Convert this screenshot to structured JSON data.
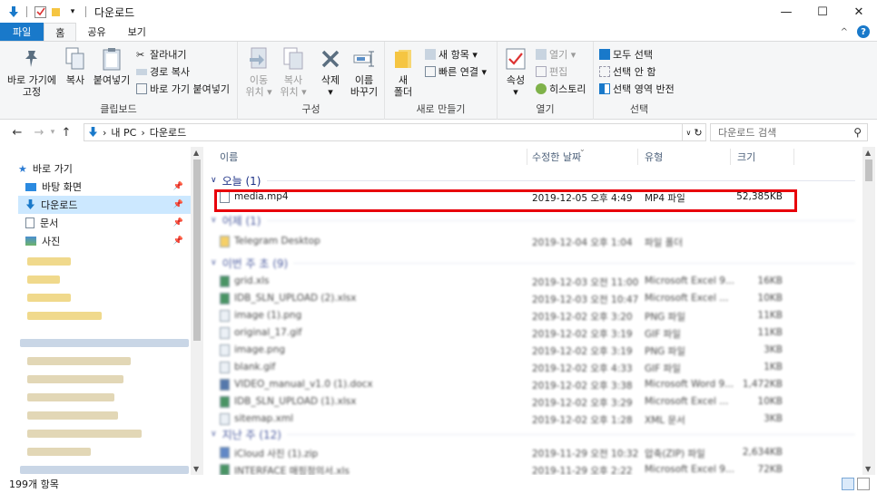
{
  "window": {
    "title": "다운로드",
    "controls": {
      "minimize": "—",
      "maximize": "☐",
      "close": "✕"
    }
  },
  "ribbon_tabs": [
    "파일",
    "홈",
    "공유",
    "보기"
  ],
  "ribbon": {
    "clipboard": {
      "pin": "바로 가기에\n고정",
      "copy": "복사",
      "paste": "붙여넣기",
      "cut": "잘라내기",
      "copy_path": "경로 복사",
      "paste_shortcut": "바로 가기 붙여넣기",
      "label": "클립보드"
    },
    "organize": {
      "move_to": "이동\n위치 ▾",
      "copy_to": "복사\n위치 ▾",
      "delete": "삭제\n▾",
      "rename": "이름\n바꾸기",
      "label": "구성"
    },
    "new": {
      "new_folder": "새\n폴더",
      "new_item": "새 항목 ▾",
      "easy_access": "빠른 연결 ▾",
      "label": "새로 만들기"
    },
    "open": {
      "properties": "속성\n▾",
      "open": "열기 ▾",
      "edit": "편집",
      "history": "히스토리",
      "label": "열기"
    },
    "select": {
      "select_all": "모두 선택",
      "select_none": "선택 안 함",
      "invert": "선택 영역 반전",
      "label": "선택"
    }
  },
  "address": {
    "path": [
      "내 PC",
      "다운로드"
    ],
    "search_placeholder": "다운로드 검색"
  },
  "nav": {
    "quick_access": "바로 가기",
    "items": [
      "바탕 화면",
      "다운로드",
      "문서",
      "사진"
    ]
  },
  "columns": {
    "name": "이름",
    "date": "수정한 날짜",
    "type": "유형",
    "size": "크기"
  },
  "groups": {
    "today": {
      "label": "오늘 (1)"
    },
    "yesterday": {
      "label": "어제 (1)"
    },
    "this_week": {
      "label": "이번 주 초 (9)"
    },
    "last_week": {
      "label": "지난 주 (12)"
    }
  },
  "files": {
    "today": [
      {
        "name": "media.mp4",
        "date": "2019-12-05 오후 4:49",
        "type": "MP4 파일",
        "size": "52,385KB"
      }
    ],
    "yesterday": [
      {
        "name": "Telegram Desktop",
        "date": "2019-12-04 오후 1:04",
        "type": "파일 폴더",
        "size": ""
      }
    ],
    "this_week": [
      {
        "name": "grid.xls",
        "date": "2019-12-03 오전 11:00",
        "type": "Microsoft Excel 9...",
        "size": "16KB"
      },
      {
        "name": "IDB_SLN_UPLOAD (2).xlsx",
        "date": "2019-12-03 오전 10:47",
        "type": "Microsoft Excel ...",
        "size": "10KB"
      },
      {
        "name": "image (1).png",
        "date": "2019-12-02 오후 3:20",
        "type": "PNG 파일",
        "size": "11KB"
      },
      {
        "name": "original_17.gif",
        "date": "2019-12-02 오후 3:19",
        "type": "GIF 파일",
        "size": "11KB"
      },
      {
        "name": "image.png",
        "date": "2019-12-02 오후 3:19",
        "type": "PNG 파일",
        "size": "3KB"
      },
      {
        "name": "blank.gif",
        "date": "2019-12-02 오후 4:33",
        "type": "GIF 파일",
        "size": "1KB"
      },
      {
        "name": "VIDEO_manual_v1.0 (1).docx",
        "date": "2019-12-02 오후 3:38",
        "type": "Microsoft Word 9...",
        "size": "1,472KB"
      },
      {
        "name": "IDB_SLN_UPLOAD (1).xlsx",
        "date": "2019-12-02 오후 3:29",
        "type": "Microsoft Excel ...",
        "size": "10KB"
      },
      {
        "name": "sitemap.xml",
        "date": "2019-12-02 오후 1:28",
        "type": "XML 문서",
        "size": "3KB"
      }
    ],
    "last_week": [
      {
        "name": "iCloud 사진 (1).zip",
        "date": "2019-11-29 오전 10:32",
        "type": "압축(ZIP) 파일",
        "size": "2,634KB"
      },
      {
        "name": "INTERFACE 매핑정의서.xls",
        "date": "2019-11-29 오후 2:22",
        "type": "Microsoft Excel 9...",
        "size": "72KB"
      }
    ]
  },
  "status": {
    "count": "199개 항목"
  },
  "colors": {
    "accent": "#1979ca",
    "highlight": "#e8000b",
    "group_header": "#1e3287",
    "selected": "#cce8ff"
  }
}
